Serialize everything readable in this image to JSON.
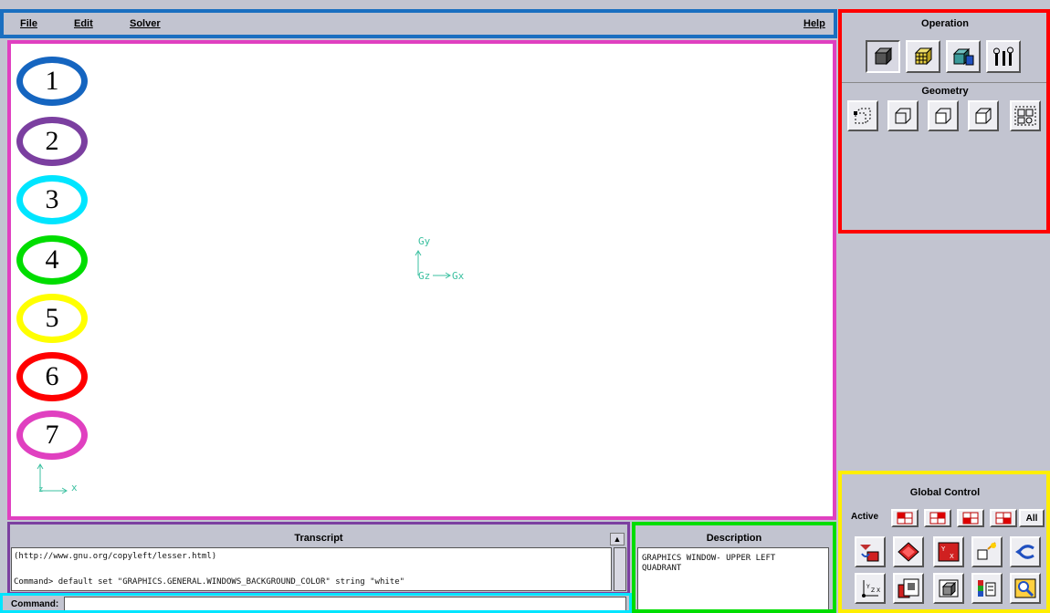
{
  "menubar": {
    "file": "File",
    "edit": "Edit",
    "solver": "Solver",
    "help": "Help"
  },
  "graphics": {
    "labels": [
      "1",
      "2",
      "3",
      "4",
      "5",
      "6",
      "7"
    ],
    "label_colors": [
      "#1565c0",
      "#7b3fa0",
      "#00e5ff",
      "#00dd00",
      "#ffff00",
      "#ff0000",
      "#e040c0"
    ],
    "axis_gy": "Gy",
    "axis_gz": "Gz",
    "axis_gx": "Gx",
    "corner_axis_x": "x",
    "corner_axis_z": "z"
  },
  "transcript": {
    "title": "Transcript",
    "lines": [
      "(http://www.gnu.org/copyleft/lesser.html)",
      "",
      "Command> default set \"GRAPHICS.GENERAL.WINDOWS_BACKGROUND_COLOR\" string \"white\""
    ]
  },
  "description": {
    "title": "Description",
    "text_line1": "GRAPHICS WINDOW- UPPER LEFT",
    "text_line2": "QUADRANT"
  },
  "command": {
    "label": "Command:",
    "value": ""
  },
  "operation": {
    "title": "Operation",
    "buttons": [
      "geometry-icon",
      "mesh-icon",
      "zones-icon",
      "tools-icon"
    ]
  },
  "geometry": {
    "title": "Geometry",
    "buttons": [
      "vertex-icon",
      "edge-icon",
      "face-icon",
      "volume-icon",
      "group-icon"
    ]
  },
  "global_control": {
    "title": "Global Control",
    "active_label": "Active",
    "all_label": "All",
    "quadrants": [
      "upper-left",
      "upper-right",
      "lower-left",
      "lower-right"
    ]
  },
  "highlight_colors": {
    "menubar": "#1a6fc0",
    "graphics": "#e040c0",
    "transcript": "#7b3fa0",
    "description": "#00dd00",
    "command": "#00e5ff",
    "operation": "#ff0000",
    "global_control": "#ffee00"
  }
}
